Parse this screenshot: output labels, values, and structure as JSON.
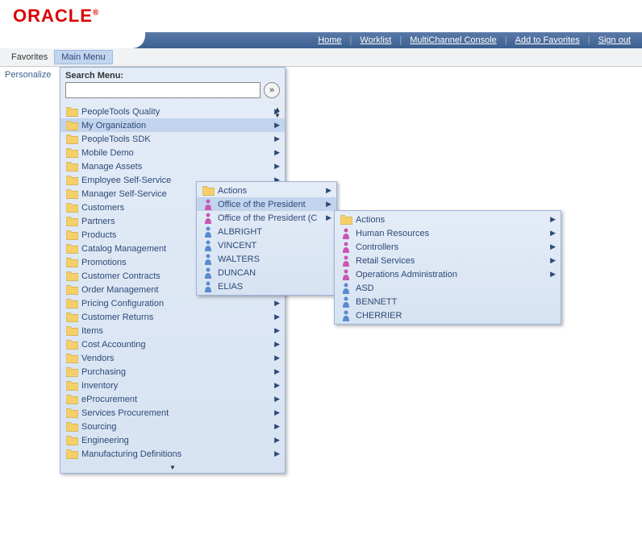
{
  "header": {
    "brand": "ORACLE",
    "brand_r": "®",
    "links": [
      "Home",
      "Worklist",
      "MultiChannel Console",
      "Add to Favorites",
      "Sign out"
    ]
  },
  "menubar": {
    "favorites": "Favorites",
    "main_menu": "Main Menu"
  },
  "personalize": "Personalize",
  "search": {
    "label": "Search Menu:",
    "value": "",
    "go": "»"
  },
  "main_items": [
    {
      "label": "PeopleTools Quality",
      "icon": "folder",
      "arrow": true
    },
    {
      "label": "My Organization",
      "icon": "folder",
      "arrow": true,
      "selected": true
    },
    {
      "label": "PeopleTools SDK",
      "icon": "folder",
      "arrow": true
    },
    {
      "label": "Mobile Demo",
      "icon": "folder",
      "arrow": true
    },
    {
      "label": "Manage Assets",
      "icon": "folder",
      "arrow": true
    },
    {
      "label": "Employee Self-Service",
      "icon": "folder",
      "arrow": true
    },
    {
      "label": "Manager Self-Service",
      "icon": "folder",
      "arrow": true
    },
    {
      "label": "Customers",
      "icon": "folder",
      "arrow": true
    },
    {
      "label": "Partners",
      "icon": "folder",
      "arrow": true
    },
    {
      "label": "Products",
      "icon": "folder",
      "arrow": true
    },
    {
      "label": "Catalog Management",
      "icon": "folder",
      "arrow": true
    },
    {
      "label": "Promotions",
      "icon": "folder",
      "arrow": true
    },
    {
      "label": "Customer Contracts",
      "icon": "folder",
      "arrow": true
    },
    {
      "label": "Order Management",
      "icon": "folder",
      "arrow": true
    },
    {
      "label": "Pricing Configuration",
      "icon": "folder",
      "arrow": true
    },
    {
      "label": "Customer Returns",
      "icon": "folder",
      "arrow": true
    },
    {
      "label": "Items",
      "icon": "folder",
      "arrow": true
    },
    {
      "label": "Cost Accounting",
      "icon": "folder",
      "arrow": true
    },
    {
      "label": "Vendors",
      "icon": "folder",
      "arrow": true
    },
    {
      "label": "Purchasing",
      "icon": "folder",
      "arrow": true
    },
    {
      "label": "Inventory",
      "icon": "folder",
      "arrow": true
    },
    {
      "label": "eProcurement",
      "icon": "folder",
      "arrow": true
    },
    {
      "label": "Services Procurement",
      "icon": "folder",
      "arrow": true
    },
    {
      "label": "Sourcing",
      "icon": "folder",
      "arrow": true
    },
    {
      "label": "Engineering",
      "icon": "folder",
      "arrow": true
    },
    {
      "label": "Manufacturing Definitions",
      "icon": "folder",
      "arrow": true
    }
  ],
  "sub1_items": [
    {
      "label": "Actions",
      "icon": "folder",
      "arrow": true
    },
    {
      "label": "Office of the President",
      "icon": "person-pink",
      "arrow": true,
      "selected": true
    },
    {
      "label": "Office of the President (C",
      "icon": "person-pink",
      "arrow": true
    },
    {
      "label": "ALBRIGHT",
      "icon": "person-blue",
      "arrow": false
    },
    {
      "label": "VINCENT",
      "icon": "person-blue",
      "arrow": false
    },
    {
      "label": "WALTERS",
      "icon": "person-blue",
      "arrow": false
    },
    {
      "label": "DUNCAN",
      "icon": "person-blue",
      "arrow": false
    },
    {
      "label": "ELIAS",
      "icon": "person-blue",
      "arrow": false
    }
  ],
  "sub2_items": [
    {
      "label": "Actions",
      "icon": "folder",
      "arrow": true
    },
    {
      "label": "Human Resources",
      "icon": "person-pink",
      "arrow": true
    },
    {
      "label": "Controllers",
      "icon": "person-pink",
      "arrow": true
    },
    {
      "label": "Retail Services",
      "icon": "person-pink",
      "arrow": true
    },
    {
      "label": "Operations Administration",
      "icon": "person-pink",
      "arrow": true
    },
    {
      "label": "ASD",
      "icon": "person-blue",
      "arrow": false
    },
    {
      "label": "BENNETT",
      "icon": "person-blue",
      "arrow": false
    },
    {
      "label": "CHERRIER",
      "icon": "person-blue",
      "arrow": false
    }
  ]
}
